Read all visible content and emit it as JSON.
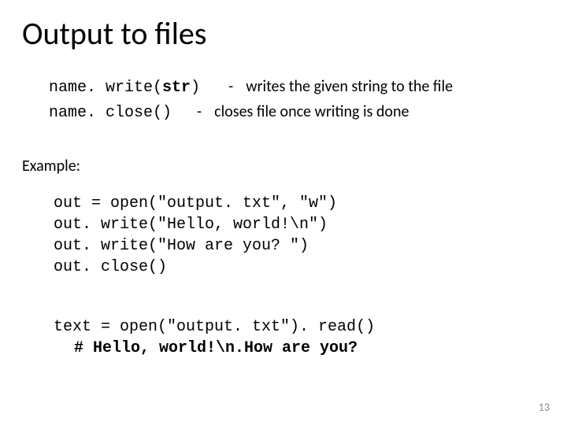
{
  "title": "Output to files",
  "api": {
    "write": {
      "prefix": "name",
      "dot": ".",
      "fn": " write(",
      "arg": "str",
      "close": ")",
      "desc_dash": "-",
      "desc": "writes the given string to the file"
    },
    "close": {
      "prefix": "name",
      "dot": ".",
      "fn": " close()",
      "desc_dash": "-",
      "desc": "closes file once writing is done"
    }
  },
  "example_label": "Example:",
  "code1": "out = open(\"output. txt\", \"w\")\nout. write(\"Hello, world!\\n\")\nout. write(\"How are you? \")\nout. close()",
  "code2_line1": "text = open(\"output. txt\"). read()",
  "code2_line2": "# Hello, world!\\n.How are you?",
  "pagenum": "13"
}
